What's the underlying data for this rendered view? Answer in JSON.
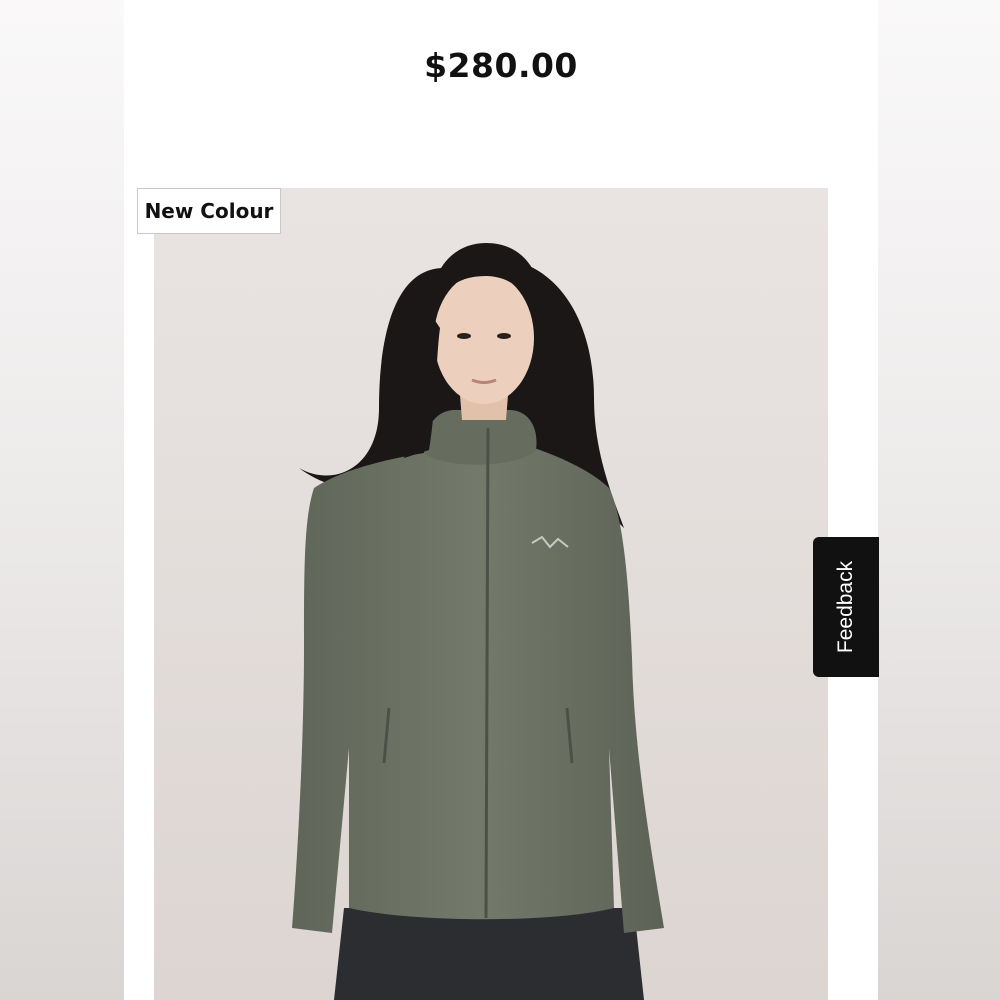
{
  "product": {
    "price": "$280.00",
    "badge": "New Colour",
    "image_alt": "Woman wearing a sage green hooded zip jacket",
    "jacket_color": "#6e7466"
  },
  "feedback": {
    "label": "Feedback"
  }
}
